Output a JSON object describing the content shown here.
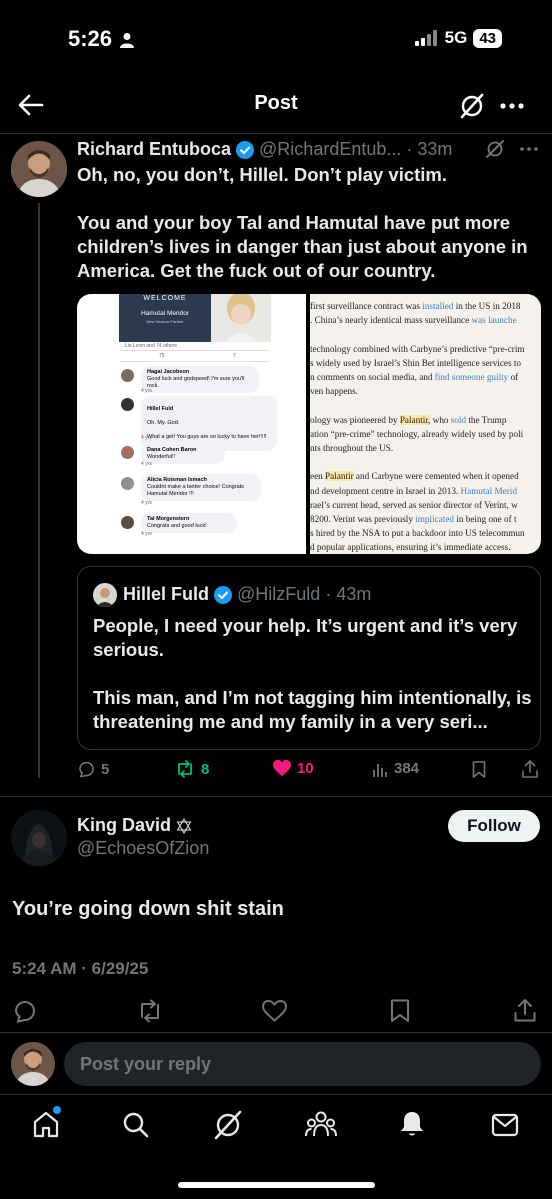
{
  "status_bar": {
    "time": "5:26",
    "network": "5G",
    "battery": "43"
  },
  "header": {
    "title": "Post"
  },
  "main_post": {
    "author_name": "Richard Entuboca",
    "author_handle": "@RichardEntub...",
    "time": "33m",
    "text": "Oh, no, you don’t, Hillel. Don’t play victim.\n\nYou and your boy Tal and Hamutal have put more children’s lives in danger than just about anyone in America. Get the fuck out of our country.",
    "media_left": {
      "banner_title": "WELCOME",
      "banner_name": "Hamutal Meridor",
      "banner_sub": "New Venture Partner",
      "likes": "Lie Levin and 74 others",
      "reactions": "75",
      "comment_count": "7",
      "comments": [
        {
          "name": "Hagai Jacobson",
          "text": "Good luck and godspeed! I'm sure you'll rock.",
          "meta": "4 yrs"
        },
        {
          "name": "Hillel Fuld",
          "text": "Oh. My. God.\n\nWhat a get! You guys are so lucky to have her!!!!!",
          "meta": "4 yrs"
        },
        {
          "name": "Dana Cohen Baron",
          "text": "Wonderful!!",
          "meta": "4 yrs"
        },
        {
          "name": "Alicia Roisman Ismach",
          "text": "Couldnt make a better choice! Congrats Hamutal Meridor !!!",
          "meta": "4 yrs"
        },
        {
          "name": "Tal Morgenstern",
          "text": "Congrats and good luck!",
          "meta": "4 yrs"
        }
      ]
    },
    "media_right": {
      "lines": [
        [
          {
            "t": "first surveillance contract was "
          },
          {
            "t": "installed",
            "c": "lk"
          },
          {
            "t": " in the US in 2018"
          }
        ],
        [
          {
            "t": ". China’s nearly identical mass surveillance "
          },
          {
            "t": "was launche",
            "c": "lk"
          }
        ],
        [
          {
            "t": ""
          }
        ],
        [
          {
            "t": "technology combined with Carbyne’s predictive “pre-crim"
          }
        ],
        [
          {
            "t": "s widely used by Israel’s Shin Bet intelligence services to"
          }
        ],
        [
          {
            "t": "n comments on social media, and "
          },
          {
            "t": "find someone guilty",
            "c": "lk"
          },
          {
            "t": " of"
          }
        ],
        [
          {
            "t": "ven happens."
          }
        ],
        [
          {
            "t": ""
          }
        ],
        [
          {
            "t": "ology was pioneered by "
          },
          {
            "t": "Palantir,",
            "c": "hl"
          },
          {
            "t": " who "
          },
          {
            "t": "sold",
            "c": "lk"
          },
          {
            "t": " the Trump"
          }
        ],
        [
          {
            "t": "ation “pre-crime” technology, already widely used by poli"
          }
        ],
        [
          {
            "t": "nts throughout the US."
          }
        ],
        [
          {
            "t": ""
          }
        ],
        [
          {
            "t": "een "
          },
          {
            "t": "Palantir",
            "c": "hl"
          },
          {
            "t": " and Carbyne were cemented when it opened"
          }
        ],
        [
          {
            "t": "nd development centre in Israel in 2013. "
          },
          {
            "t": "Hamutal Merid",
            "c": "lk"
          }
        ],
        [
          {
            "t": "rael’s current head, served as senior director of Verint, w"
          }
        ],
        [
          {
            "t": " 8200. Verint was previously "
          },
          {
            "t": "implicated",
            "c": "lk"
          },
          {
            "t": " in being one of t"
          }
        ],
        [
          {
            "t": "s hired by the NSA to put a backdoor into US telecommun"
          }
        ],
        [
          {
            "t": "d popular applications, ensuring it’s immediate access."
          }
        ]
      ]
    },
    "quote": {
      "author_name": "Hillel Fuld",
      "author_handle": "@HilzFuld",
      "time": "43m",
      "text": "People, I need your help. It’s urgent and it’s very serious.\n\nThis man, and I’m not tagging him intentionally, is threatening me and my family in a very seri..."
    },
    "actions": {
      "replies": "5",
      "reposts": "8",
      "likes": "10",
      "views": "384"
    }
  },
  "reply_post": {
    "author_name": "King David",
    "author_handle": "@EchoesOfZion",
    "follow_label": "Follow",
    "text": "You’re going down shit stain",
    "timestamp": "5:24 AM · 6/29/25"
  },
  "reply_bar": {
    "placeholder": "Post your reply"
  },
  "colors": {
    "verified": "#1d9bf0",
    "repost_active": "#00ba7c",
    "like_active": "#f91880",
    "muted": "#71767b",
    "notification_dot": "#1d9bf0"
  },
  "icons": [
    "person-icon",
    "signal-icon",
    "back-arrow-icon",
    "grok-icon",
    "more-icon",
    "verified-icon",
    "reply-icon",
    "repost-icon",
    "heart-icon",
    "views-icon",
    "bookmark-icon",
    "share-icon",
    "star-of-david-icon",
    "home-icon",
    "search-icon",
    "people-icon",
    "bell-icon",
    "mail-icon"
  ]
}
